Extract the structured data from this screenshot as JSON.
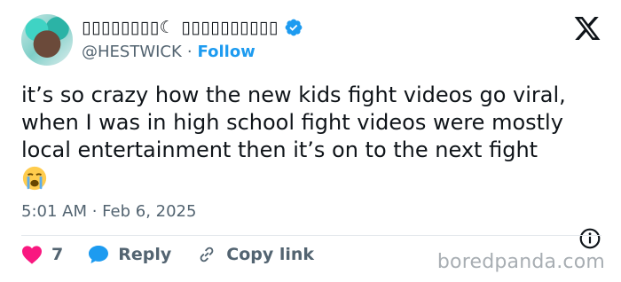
{
  "author": {
    "display_name": "▯▯▯▯▯▯▯▯☾ ▯▯▯▯▯▯▯▯▯▯",
    "handle": "@HESTWICK",
    "separator": "·",
    "follow_label": "Follow"
  },
  "tweet": {
    "text": "it’s so crazy how the new kids fight videos go viral, when I was in high school fight videos were mostly local entertainment then it’s on to the next fight",
    "emoji": "😭",
    "timestamp": "5:01 AM · Feb 6, 2025"
  },
  "actions": {
    "like_count": "7",
    "reply_label": "Reply",
    "copy_link_label": "Copy link"
  },
  "watermark": "boredpanda.com",
  "colors": {
    "accent": "#1d9bf0",
    "like": "#f91880",
    "muted": "#536471"
  },
  "icons": [
    "verified-badge-icon",
    "x-logo-icon",
    "info-icon",
    "heart-icon",
    "reply-bubble-icon",
    "link-icon"
  ]
}
